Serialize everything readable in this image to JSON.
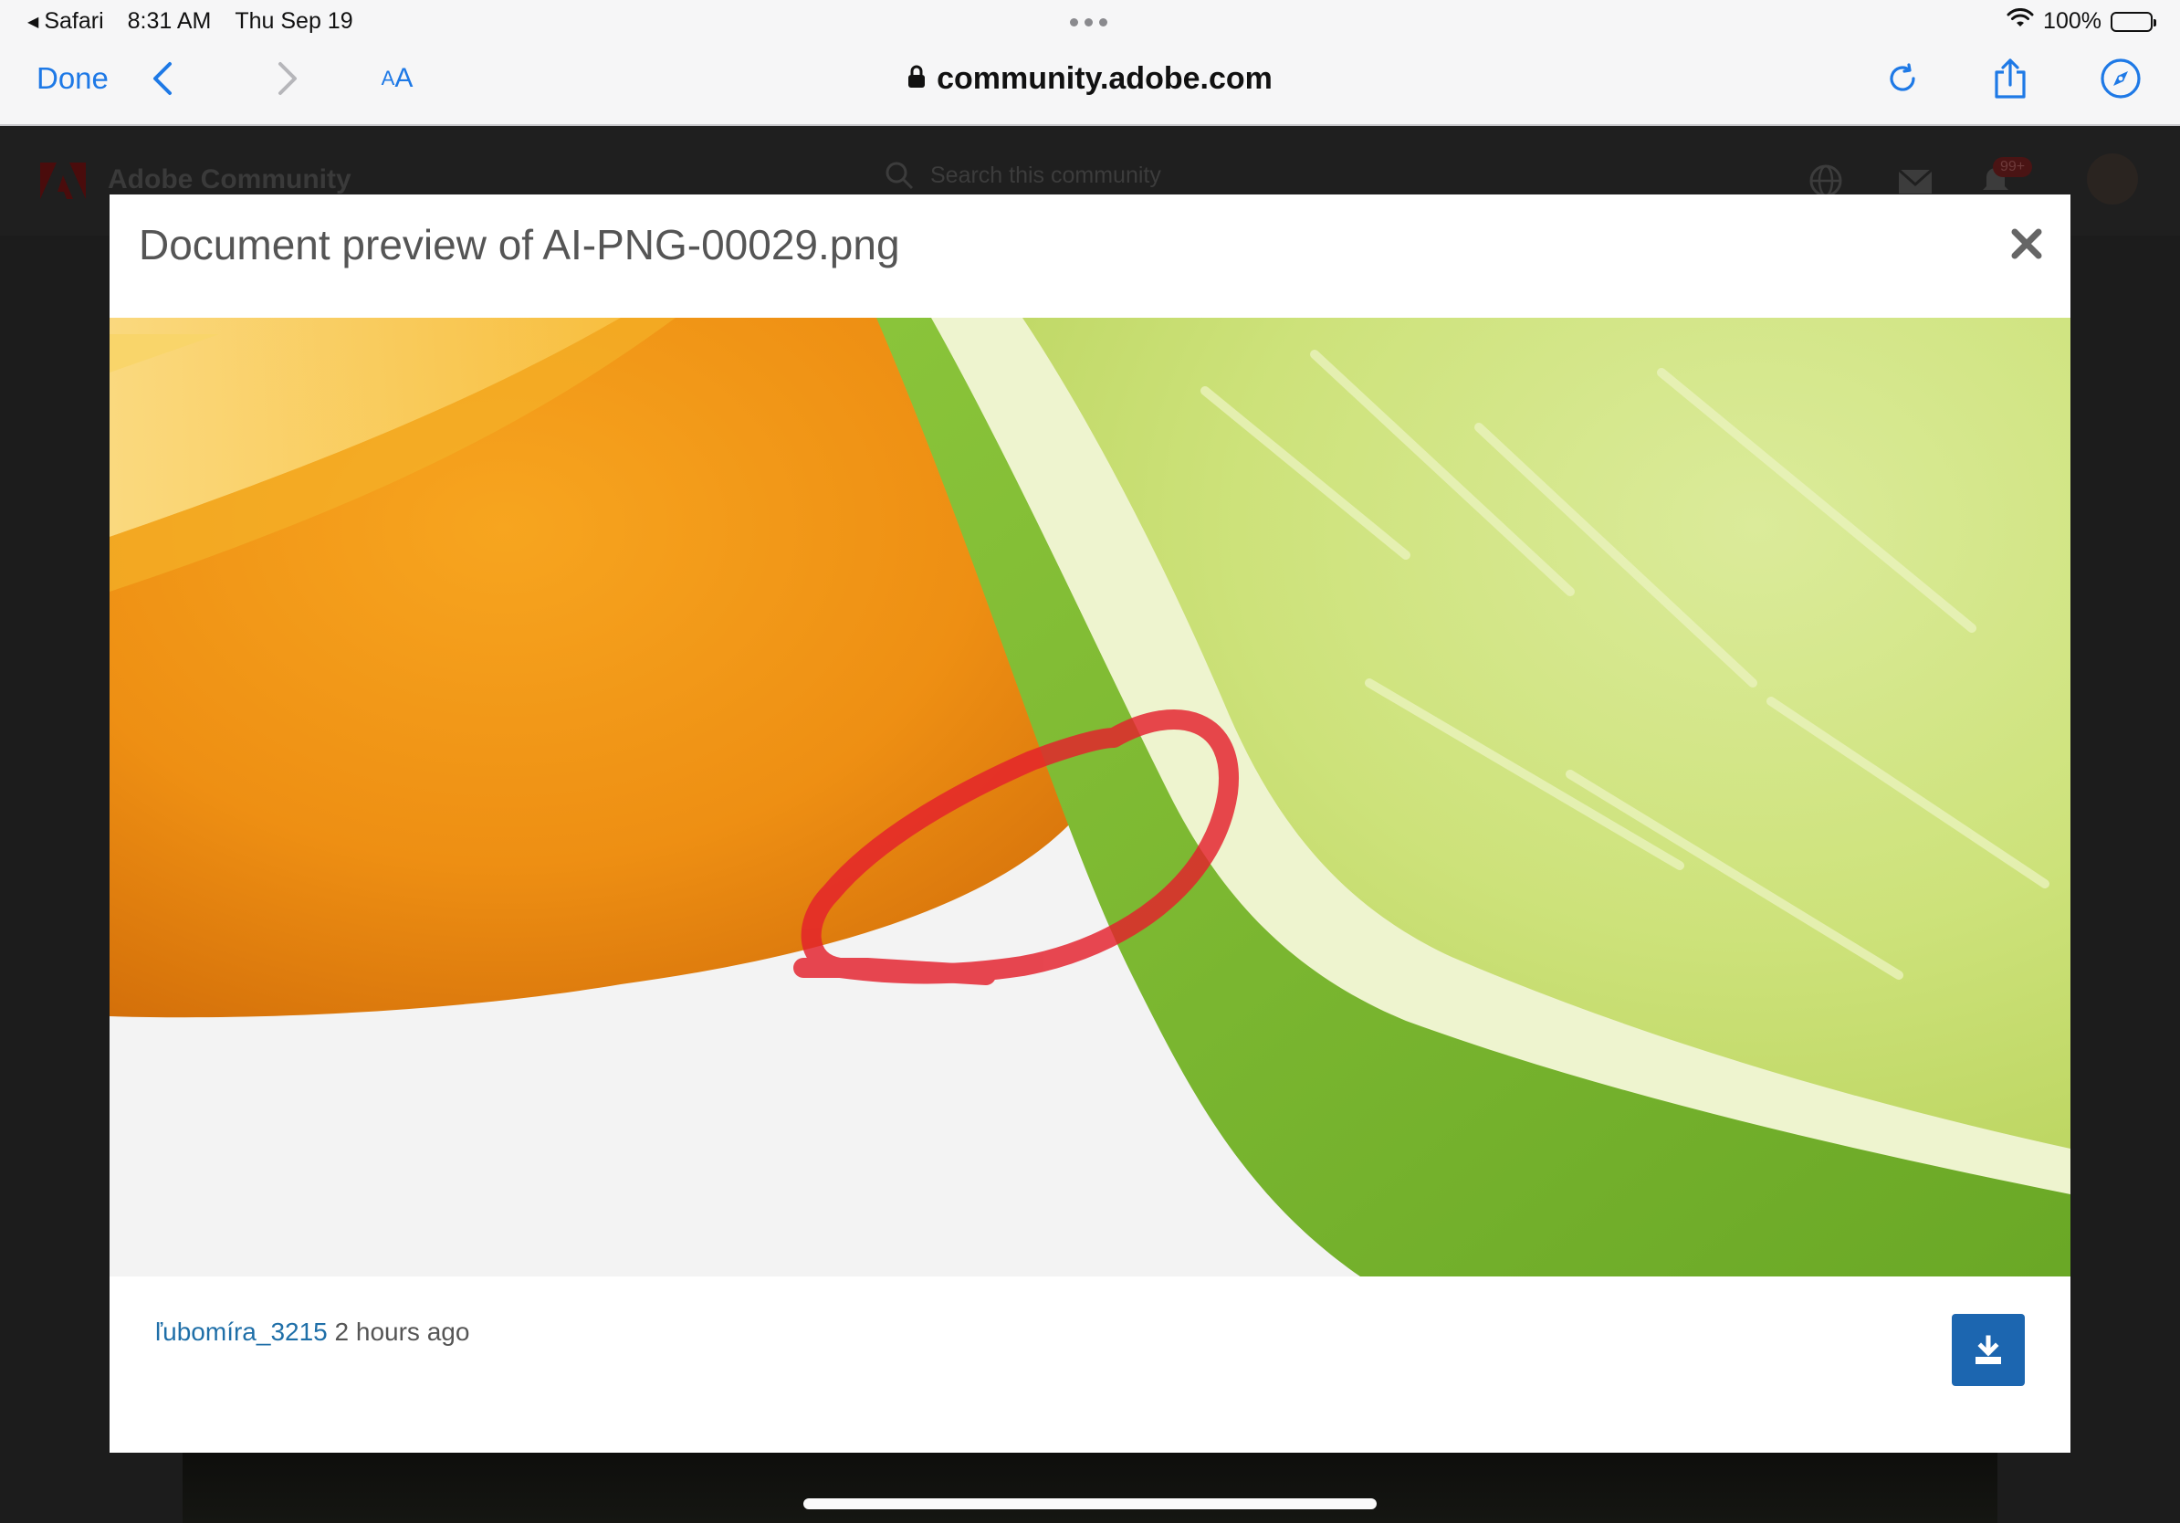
{
  "status_bar": {
    "back_app": "Safari",
    "time": "8:31 AM",
    "date": "Thu Sep 19",
    "battery": "100%"
  },
  "toolbar": {
    "done_label": "Done",
    "text_size_small": "A",
    "text_size_large": "A",
    "url": "community.adobe.com"
  },
  "page": {
    "community_name": "Adobe Community",
    "search_placeholder": "Search this community",
    "notification_count": "99+"
  },
  "modal": {
    "title": "Document preview of AI-PNG-00029.png",
    "author": "ľubomíra_3215",
    "posted": "2 hours ago"
  },
  "colors": {
    "ios_blue": "#1e79e6",
    "link_blue": "#1f6fa8",
    "download_button": "#1c66b0",
    "annotation_red": "#e4202c"
  }
}
